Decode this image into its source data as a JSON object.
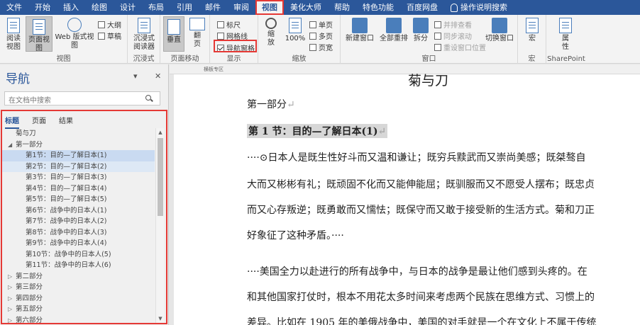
{
  "menu": {
    "items": [
      "文件",
      "开始",
      "插入",
      "绘图",
      "设计",
      "布局",
      "引用",
      "邮件",
      "审阅",
      "视图",
      "美化大师",
      "帮助",
      "特色功能",
      "百度网盘"
    ],
    "active": "视图",
    "search_label": "操作说明搜索"
  },
  "ribbon": {
    "views": {
      "label": "视图",
      "read_mode": "阅读\n视图",
      "page_view": "页面视图",
      "web_view": "Web 版式视图",
      "outline": "大纲",
      "draft": "草稿"
    },
    "immersive": {
      "label": "沉浸式",
      "reader": "沉浸式\n阅读器"
    },
    "page_move": {
      "label": "页面移动",
      "vertical": "垂直",
      "side": "翻\n页"
    },
    "show": {
      "label": "显示",
      "ruler": "标尺",
      "gridlines": "网格线",
      "nav_pane": "导航窗格",
      "ruler_checked": false,
      "gridlines_checked": false,
      "nav_pane_checked": true
    },
    "zoom": {
      "label": "缩放",
      "zoom": "缩\n放",
      "pct": "100%",
      "one_page": "单页",
      "multi_page": "多页",
      "page_width": "页宽"
    },
    "window": {
      "label": "窗口",
      "new_window": "新建窗口",
      "arrange_all": "全部重排",
      "split": "拆分",
      "side_by_side": "并排查看",
      "sync_scroll": "同步滚动",
      "reset_pos": "重设窗口位置",
      "switch": "切换窗口"
    },
    "macros": {
      "label": "宏",
      "macro": "宏"
    },
    "sharepoint": {
      "label": "SharePoint",
      "props": "属\n性"
    }
  },
  "nav": {
    "title": "导航",
    "search_placeholder": "在文档中搜索",
    "tabs": [
      "标题",
      "页面",
      "结果"
    ],
    "active_tab": "标题",
    "tree": [
      {
        "text": "菊与刀",
        "level": 1,
        "arrow": ""
      },
      {
        "text": "第一部分",
        "level": 1,
        "arrow": "◢"
      },
      {
        "text": "第1节：目的—了解日本(1)",
        "level": 2,
        "arrow": "",
        "state": "cur"
      },
      {
        "text": "第2节：目的—了解日本(2)",
        "level": 2,
        "arrow": "",
        "state": "sel"
      },
      {
        "text": "第3节：目的—了解日本(3)",
        "level": 2,
        "arrow": ""
      },
      {
        "text": "第4节：目的—了解日本(4)",
        "level": 2,
        "arrow": ""
      },
      {
        "text": "第5节：目的—了解日本(5)",
        "level": 2,
        "arrow": ""
      },
      {
        "text": "第6节：战争中的日本人(1)",
        "level": 2,
        "arrow": ""
      },
      {
        "text": "第7节：战争中的日本人(2)",
        "level": 2,
        "arrow": ""
      },
      {
        "text": "第8节：战争中的日本人(3)",
        "level": 2,
        "arrow": ""
      },
      {
        "text": "第9节：战争中的日本人(4)",
        "level": 2,
        "arrow": ""
      },
      {
        "text": "第10节：战争中的日本人(5)",
        "level": 2,
        "arrow": ""
      },
      {
        "text": "第11节：战争中的日本人(6)",
        "level": 2,
        "arrow": ""
      },
      {
        "text": "第二部分",
        "level": 1,
        "arrow": "▷"
      },
      {
        "text": "第三部分",
        "level": 1,
        "arrow": "▷"
      },
      {
        "text": "第四部分",
        "level": 1,
        "arrow": "▷"
      },
      {
        "text": "第五部分",
        "level": 1,
        "arrow": "▷"
      },
      {
        "text": "第六部分",
        "level": 1,
        "arrow": "▷"
      }
    ]
  },
  "doc": {
    "ruler_text": "横板专区",
    "title": "菊与刀",
    "section": "第一部分",
    "heading": "第 1 节：目的—了解日本(1)",
    "lines": [
      "····⊙日本人是既生性好斗而又温和谦让；既穷兵黩武而又崇尚美感；既桀骜自",
      "大而又彬彬有礼；既顽固不化而又能伸能屈；既驯服而又不愿受人摆布；既忠贞",
      "而又心存叛逆；既勇敢而又懦怯；既保守而又敢于接受新的生活方式。菊和刀正",
      "好象征了这种矛盾。····",
      "····美国全力以赴进行的所有战争中，与日本的战争是最让他们感到头疼的。在",
      "和其他国家打仗时，根本不用花太多时间来考虑两个民族在思维方式、习惯上的",
      "差异。比如在 1905 年的美俄战争中，美国的对手就是一个在文化上不属于传统"
    ]
  }
}
